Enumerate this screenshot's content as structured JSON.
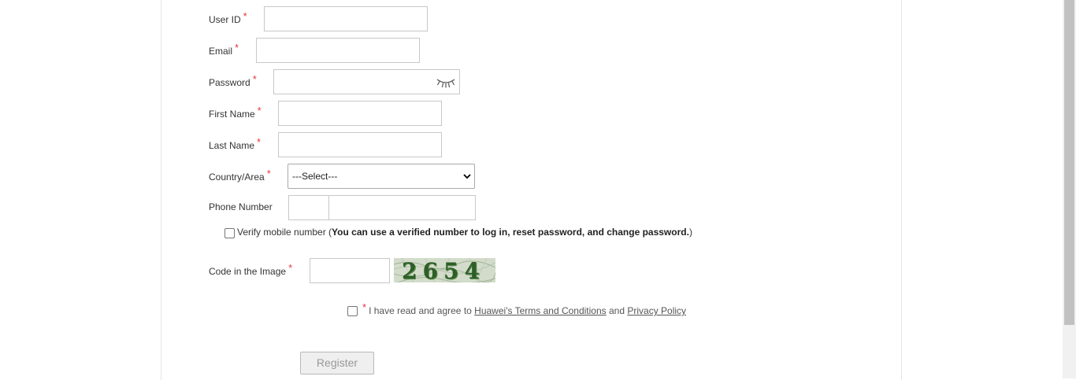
{
  "form": {
    "user_id": {
      "label": "User ID",
      "value": ""
    },
    "email": {
      "label": "Email",
      "value": ""
    },
    "password": {
      "label": "Password",
      "value": "",
      "icon": "eye-closed-icon"
    },
    "first_name": {
      "label": "First Name",
      "value": ""
    },
    "last_name": {
      "label": "Last Name",
      "value": ""
    },
    "country": {
      "label": "Country/Area",
      "selected": "---Select---"
    },
    "phone": {
      "label": "Phone Number",
      "code": "",
      "number": ""
    },
    "required_mark": "*",
    "verify": {
      "prefix": "Verify mobile number (",
      "bold": "You can use a verified number to log in, reset password, and change password.",
      "suffix": ")",
      "checked": false
    },
    "captcha": {
      "label": "Code in the Image",
      "value": "",
      "image_code": "2654"
    },
    "agree": {
      "text_before": "I have read and agree to",
      "terms_link": "Huawei's Terms and Conditions",
      "and": "and",
      "privacy_link": "Privacy Policy",
      "checked": false
    },
    "register_label": "Register"
  },
  "colors": {
    "required": "#e4393c",
    "captcha_text": "#2e5e28",
    "button_disabled_text": "#999999"
  }
}
